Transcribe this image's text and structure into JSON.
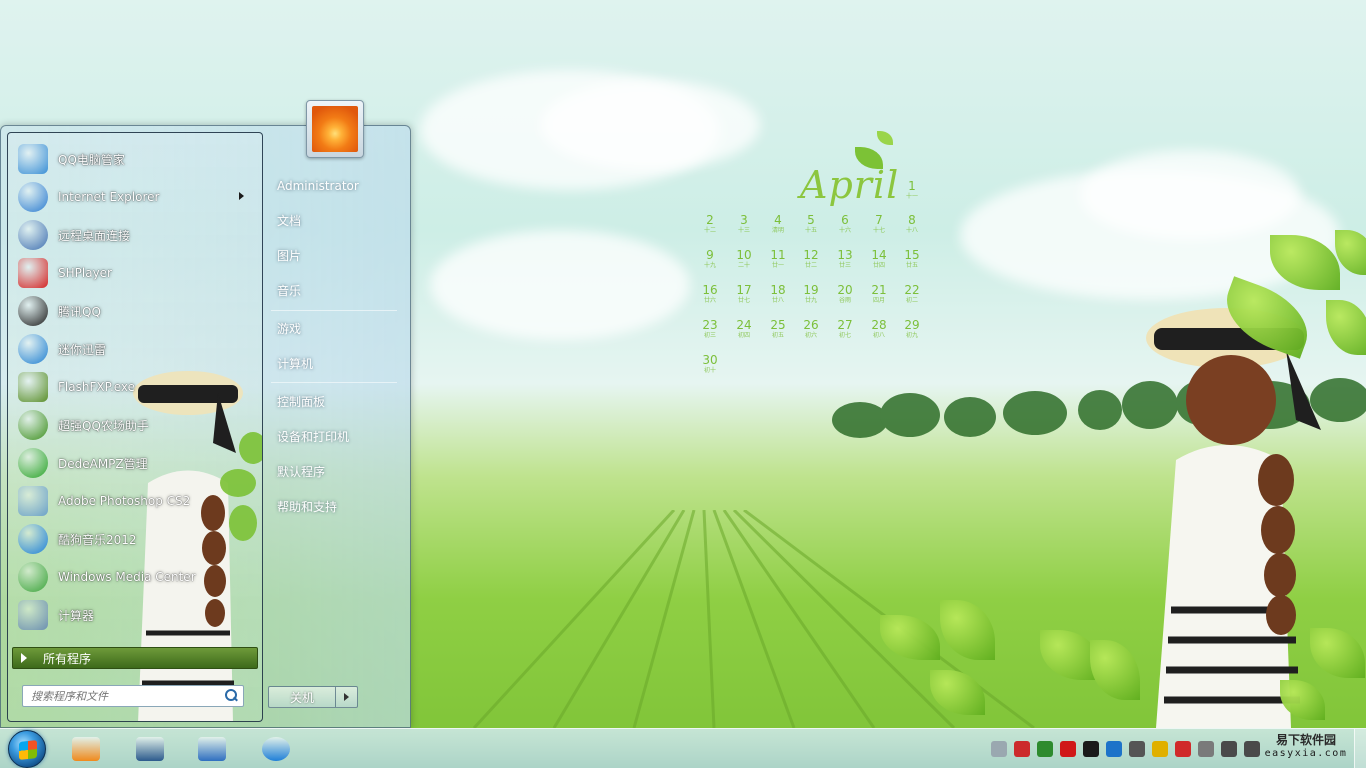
{
  "calendar": {
    "month": "April",
    "days": [
      {
        "n": "1",
        "l": "十一"
      },
      {
        "n": "2",
        "l": "十二"
      },
      {
        "n": "3",
        "l": "十三"
      },
      {
        "n": "4",
        "l": "清明"
      },
      {
        "n": "5",
        "l": "十五"
      },
      {
        "n": "6",
        "l": "十六"
      },
      {
        "n": "7",
        "l": "十七"
      },
      {
        "n": "8",
        "l": "十八"
      },
      {
        "n": "9",
        "l": "十九"
      },
      {
        "n": "10",
        "l": "二十"
      },
      {
        "n": "11",
        "l": "廿一"
      },
      {
        "n": "12",
        "l": "廿二"
      },
      {
        "n": "13",
        "l": "廿三"
      },
      {
        "n": "14",
        "l": "廿四"
      },
      {
        "n": "15",
        "l": "廿五"
      },
      {
        "n": "16",
        "l": "廿六"
      },
      {
        "n": "17",
        "l": "廿七"
      },
      {
        "n": "18",
        "l": "廿八"
      },
      {
        "n": "19",
        "l": "廿九"
      },
      {
        "n": "20",
        "l": "谷雨"
      },
      {
        "n": "21",
        "l": "四月"
      },
      {
        "n": "22",
        "l": "初二"
      },
      {
        "n": "23",
        "l": "初三"
      },
      {
        "n": "24",
        "l": "初四"
      },
      {
        "n": "25",
        "l": "初五"
      },
      {
        "n": "26",
        "l": "初六"
      },
      {
        "n": "27",
        "l": "初七"
      },
      {
        "n": "28",
        "l": "初八"
      },
      {
        "n": "29",
        "l": "初九"
      },
      {
        "n": "30",
        "l": "初十"
      }
    ]
  },
  "start_menu": {
    "programs": [
      {
        "label": "QQ电脑管家",
        "icon": "qq-guard-icon",
        "color": "#3a8fd6",
        "submenu": false
      },
      {
        "label": "Internet Explorer",
        "icon": "internet-explorer-icon",
        "color": "#2b7bd0",
        "submenu": true
      },
      {
        "label": "远程桌面连接",
        "icon": "remote-desktop-icon",
        "color": "#3f6fb0",
        "submenu": false
      },
      {
        "label": "SHPlayer",
        "icon": "shplayer-icon",
        "color": "#d42525",
        "submenu": false
      },
      {
        "label": "腾讯QQ",
        "icon": "tencent-qq-icon",
        "color": "#1c1c1c",
        "submenu": false
      },
      {
        "label": "迷你迅雷",
        "icon": "mini-thunder-icon",
        "color": "#1f7fd1",
        "submenu": false
      },
      {
        "label": "FlashFXP.exe",
        "icon": "flashfxp-icon",
        "color": "#5a8f2a",
        "submenu": false
      },
      {
        "label": "超强QQ农场助手",
        "icon": "qq-farm-tree-icon",
        "color": "#3d8f1f",
        "submenu": false
      },
      {
        "label": "DedeAMPZ管理",
        "icon": "dedeampz-cube-icon",
        "color": "#2aa32a",
        "submenu": false
      },
      {
        "label": "Adobe Photoshop CS2",
        "icon": "photoshop-feather-icon",
        "color": "#6aa0c8",
        "submenu": false
      },
      {
        "label": "酷狗音乐2012",
        "icon": "kugou-music-icon",
        "color": "#1d7fd8",
        "submenu": false
      },
      {
        "label": "Windows Media Center",
        "icon": "windows-media-center-icon",
        "color": "#3aa33a",
        "submenu": false
      },
      {
        "label": "计算器",
        "icon": "calculator-icon",
        "color": "#6b8fb0",
        "submenu": false
      }
    ],
    "all_programs": "所有程序",
    "search_placeholder": "搜索程序和文件",
    "right_links": [
      "Administrator",
      "文档",
      "图片",
      "音乐",
      "游戏",
      "计算机",
      "控制面板",
      "设备和打印机",
      "默认程序",
      "帮助和支持"
    ],
    "shutdown_label": "关机"
  },
  "taskbar": {
    "pinned": [
      {
        "name": "media-player-icon",
        "color": "#f08a1c"
      },
      {
        "name": "window-switcher-icon",
        "color": "#2c5a8c"
      },
      {
        "name": "show-desktop-icon",
        "color": "#2f6fc0"
      },
      {
        "name": "internet-explorer-taskbar-icon",
        "color": "#1f7fd8"
      }
    ],
    "tray_icons": [
      {
        "name": "keyboard-icon",
        "color": "#9aa8b0"
      },
      {
        "name": "network-arrow-icon",
        "color": "#cc2b2b"
      },
      {
        "name": "tree-icon",
        "color": "#2e8b2e"
      },
      {
        "name": "ati-icon",
        "color": "#d01818"
      },
      {
        "name": "qq-penguin-icon",
        "color": "#1a1a1a"
      },
      {
        "name": "bluetooth-icon",
        "color": "#1d73c9"
      },
      {
        "name": "shield-icon",
        "color": "#555555"
      },
      {
        "name": "plus-icon",
        "color": "#e0b000"
      },
      {
        "name": "action-center-flag-icon",
        "color": "#d02a2a"
      },
      {
        "name": "usb-icon",
        "color": "#7a7a7a"
      },
      {
        "name": "signal-icon",
        "color": "#4a4a4a"
      },
      {
        "name": "volume-icon",
        "color": "#4a4a4a"
      }
    ],
    "brand_cn": "易下软件园",
    "brand_en": "easyxia.com"
  }
}
